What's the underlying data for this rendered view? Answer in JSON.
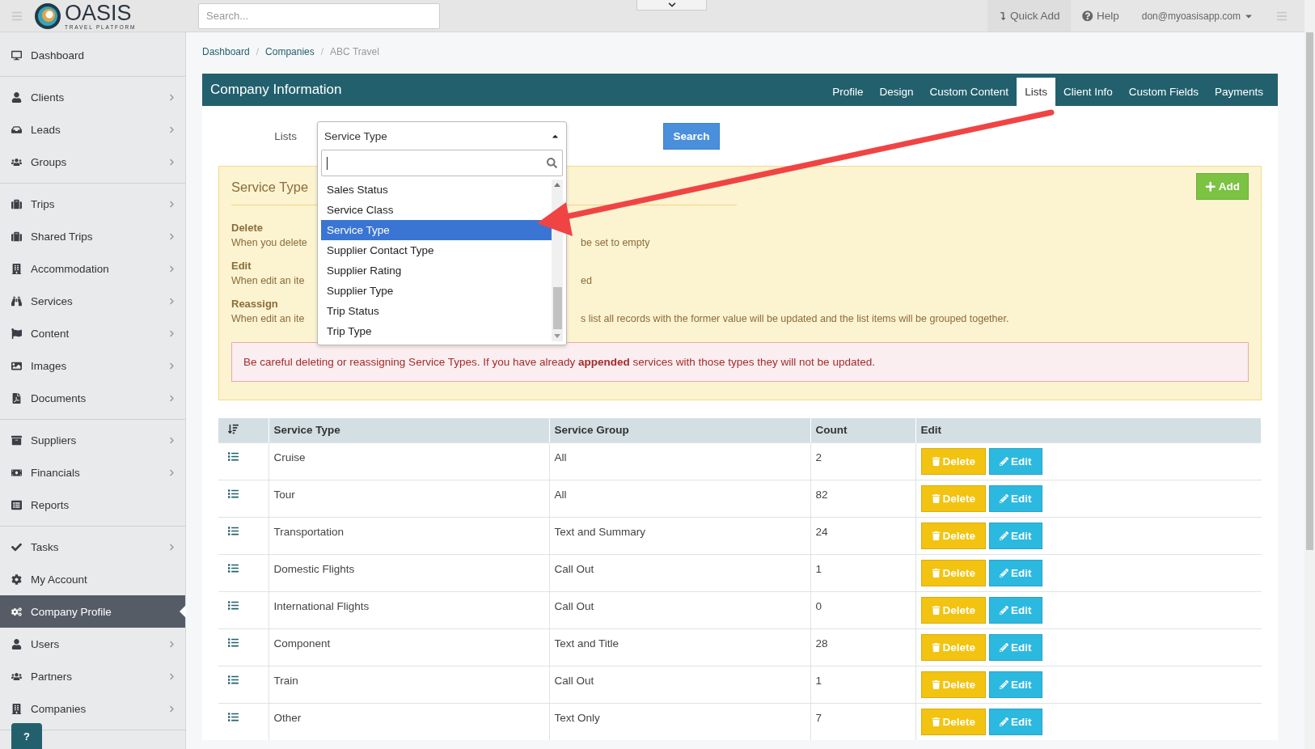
{
  "topbar": {
    "logo": {
      "name": "OASIS",
      "tagline": "TRAVEL PLATFORM"
    },
    "search": {
      "placeholder": "Search..."
    },
    "actions": [
      {
        "label": "Quick Add",
        "kind": "quick"
      },
      {
        "label": "Help",
        "kind": "help"
      },
      {
        "label": "don@myoasisapp.com",
        "kind": "user"
      }
    ]
  },
  "sidebar": {
    "groups": [
      {
        "items": [
          {
            "label": "Dashboard",
            "has_submenu": false,
            "selected": false
          }
        ]
      },
      {
        "items": [
          {
            "label": "Clients",
            "has_submenu": true,
            "selected": false
          },
          {
            "label": "Leads",
            "has_submenu": true,
            "selected": false
          },
          {
            "label": "Groups",
            "has_submenu": true,
            "selected": false
          }
        ]
      },
      {
        "items": [
          {
            "label": "Trips",
            "has_submenu": true,
            "selected": false
          },
          {
            "label": "Shared Trips",
            "has_submenu": true,
            "selected": false
          },
          {
            "label": "Accommodation",
            "has_submenu": true,
            "selected": false
          },
          {
            "label": "Services",
            "has_submenu": true,
            "selected": false
          },
          {
            "label": "Content",
            "has_submenu": true,
            "selected": false
          },
          {
            "label": "Images",
            "has_submenu": true,
            "selected": false
          },
          {
            "label": "Documents",
            "has_submenu": true,
            "selected": false
          }
        ]
      },
      {
        "items": [
          {
            "label": "Suppliers",
            "has_submenu": true,
            "selected": false
          },
          {
            "label": "Financials",
            "has_submenu": true,
            "selected": false
          },
          {
            "label": "Reports",
            "has_submenu": false,
            "selected": false
          }
        ]
      },
      {
        "items": [
          {
            "label": "Tasks",
            "has_submenu": true,
            "selected": false
          },
          {
            "label": "My Account",
            "has_submenu": false,
            "selected": false
          },
          {
            "label": "Company Profile",
            "has_submenu": false,
            "selected": true
          },
          {
            "label": "Users",
            "has_submenu": true,
            "selected": false
          },
          {
            "label": "Partners",
            "has_submenu": true,
            "selected": false
          },
          {
            "label": "Companies",
            "has_submenu": true,
            "selected": false
          }
        ]
      }
    ],
    "help_button": "?"
  },
  "breadcrumb": [
    {
      "label": "Dashboard",
      "current": false
    },
    {
      "separator": "/",
      "label": "Companies",
      "current": false
    },
    {
      "separator": "/",
      "label": "ABC Travel",
      "current": true
    }
  ],
  "card": {
    "title": "Company Information",
    "tabs": [
      {
        "label": "Profile",
        "selected": false
      },
      {
        "label": "Design",
        "selected": false
      },
      {
        "label": "Custom Content",
        "selected": false
      },
      {
        "label": "Lists",
        "selected": true
      },
      {
        "label": "Client Info",
        "selected": false
      },
      {
        "label": "Custom Fields",
        "selected": false
      },
      {
        "label": "Payments",
        "selected": false
      }
    ]
  },
  "lists_filter": {
    "label": "Lists",
    "value": "Service Type",
    "search_button": "Search",
    "dropdown": {
      "expanded": true,
      "options": [
        {
          "label": "Sales Status",
          "selected": false
        },
        {
          "label": "Service Class",
          "selected": false
        },
        {
          "label": "Service Type",
          "selected": true
        },
        {
          "label": "Supplier Contact Type",
          "selected": false
        },
        {
          "label": "Supplier Rating",
          "selected": false
        },
        {
          "label": "Supplier Type",
          "selected": false
        },
        {
          "label": "Trip Status",
          "selected": false
        },
        {
          "label": "Trip Type",
          "selected": false
        }
      ]
    }
  },
  "info_panel": {
    "title": "Service Type",
    "add_button": "Add",
    "sections": [
      {
        "heading": "Delete",
        "text_start": "When you delete",
        "text_end": "be set to empty"
      },
      {
        "heading": "Edit",
        "text_start": "When edit an ite",
        "text_end": "ed"
      },
      {
        "heading": "Reassign",
        "text_start": "When edit an ite",
        "text_end": "s list all records with the former value will be updated and the list items will be grouped together."
      }
    ],
    "warning": "Be careful deleting or reassigning Service Types. If you have already **appended** services with those types they will not be updated."
  },
  "table": {
    "columns": [
      "Service Type",
      "Service Group",
      "Count",
      "Edit"
    ],
    "rows": [
      {
        "service_type": "Cruise",
        "service_group": "All",
        "count": "2",
        "delete": "Delete",
        "edit": "Edit"
      },
      {
        "service_type": "Tour",
        "service_group": "All",
        "count": "82",
        "delete": "Delete",
        "edit": "Edit"
      },
      {
        "service_type": "Transportation",
        "service_group": "Text and Summary",
        "count": "24",
        "delete": "Delete",
        "edit": "Edit"
      },
      {
        "service_type": "Domestic Flights",
        "service_group": "Call Out",
        "count": "1",
        "delete": "Delete",
        "edit": "Edit"
      },
      {
        "service_type": "International Flights",
        "service_group": "Call Out",
        "count": "0",
        "delete": "Delete",
        "edit": "Edit"
      },
      {
        "service_type": "Component",
        "service_group": "Text and Title",
        "count": "28",
        "delete": "Delete",
        "edit": "Edit"
      },
      {
        "service_type": "Train",
        "service_group": "Call Out",
        "count": "1",
        "delete": "Delete",
        "edit": "Edit"
      },
      {
        "service_type": "Other",
        "service_group": "Text Only",
        "count": "7",
        "delete": "Delete",
        "edit": "Edit"
      }
    ]
  }
}
